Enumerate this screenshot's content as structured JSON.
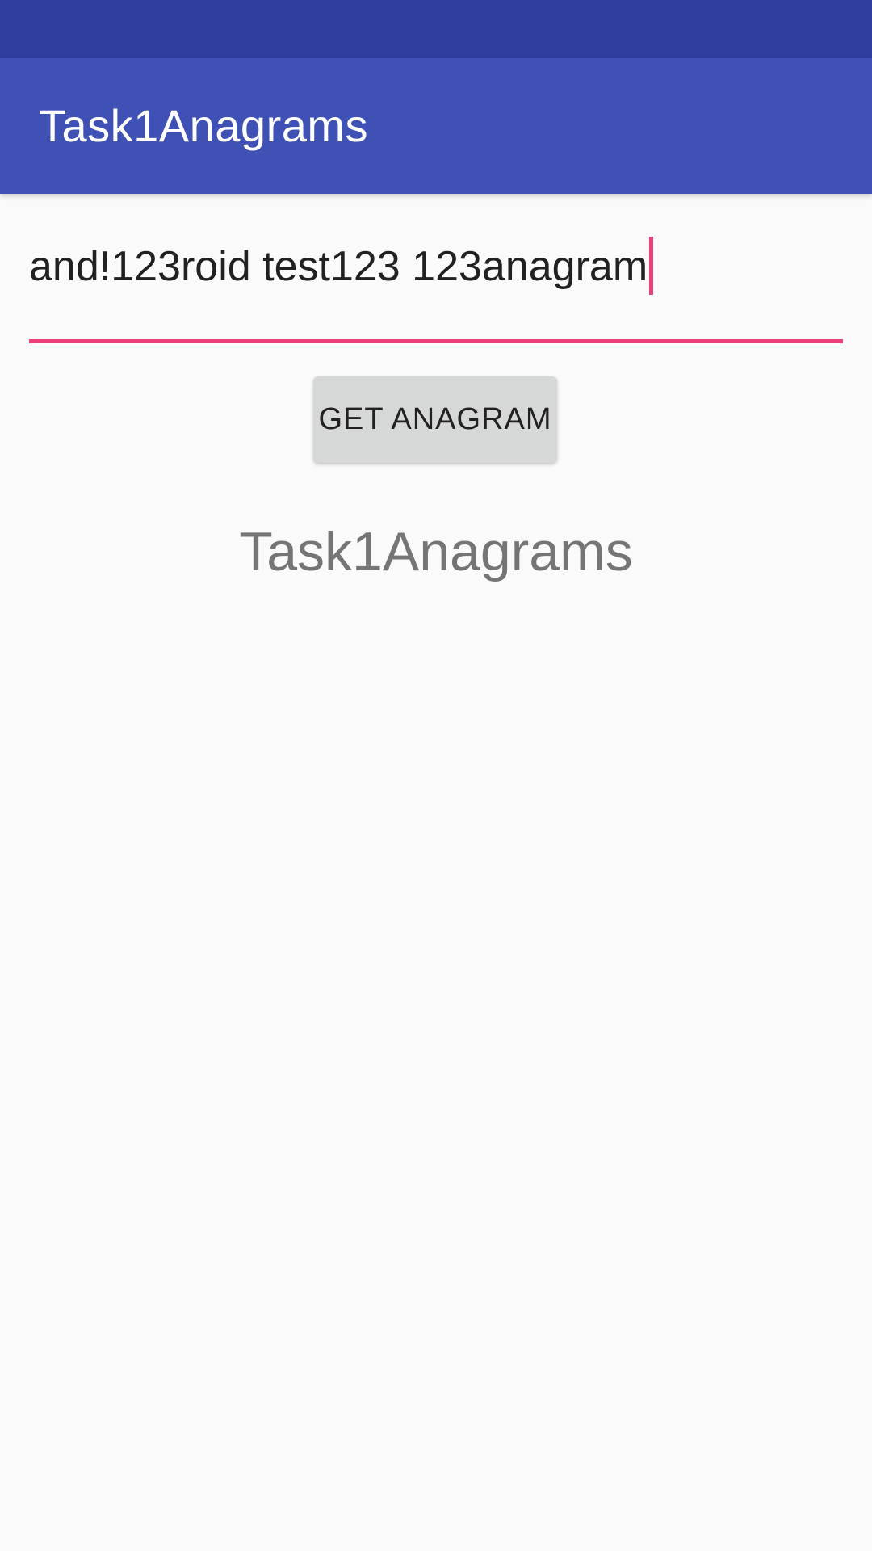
{
  "app_bar": {
    "title": "Task1Anagrams"
  },
  "input": {
    "value": "and!123roid test123 123anagram"
  },
  "button": {
    "label": "GET ANAGRAM"
  },
  "result": {
    "text": "Task1Anagrams"
  },
  "colors": {
    "status_bar": "#303f9f",
    "app_bar": "#3f51b5",
    "accent": "#ec407a",
    "button_bg": "#d6d7d7"
  }
}
